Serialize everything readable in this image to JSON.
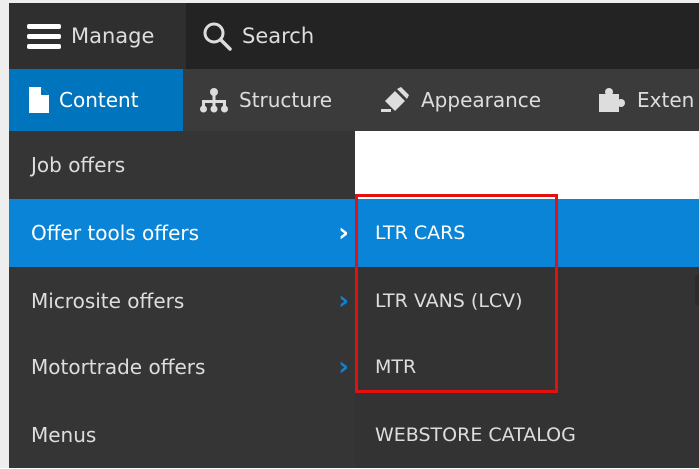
{
  "topbar": {
    "manage_label": "Manage",
    "search_label": "Search"
  },
  "tabs": [
    {
      "label": "Content",
      "icon": "document-icon",
      "active": true
    },
    {
      "label": "Structure",
      "icon": "sitemap-icon",
      "active": false
    },
    {
      "label": "Appearance",
      "icon": "paint-icon",
      "active": false
    },
    {
      "label": "Exten",
      "icon": "puzzle-icon",
      "active": false
    }
  ],
  "menu_level1": [
    {
      "label": "Job offers",
      "has_children": false,
      "active": false
    },
    {
      "label": "Offer tools offers",
      "has_children": true,
      "active": true
    },
    {
      "label": "Microsite offers",
      "has_children": true,
      "active": false
    },
    {
      "label": "Motortrade offers",
      "has_children": true,
      "active": false
    },
    {
      "label": "Menus",
      "has_children": false,
      "active": false
    }
  ],
  "menu_level2": [
    {
      "label": "LTR CARS",
      "active": true
    },
    {
      "label": "LTR VANS (LCV)",
      "active": false
    },
    {
      "label": "MTR",
      "active": false
    },
    {
      "label": "WEBSTORE CATALOG",
      "active": false
    }
  ],
  "colors": {
    "accent": "#0a84d6",
    "highlight_box": "#e41010",
    "toolbar_dark": "#232323",
    "menu_bg": "#353535"
  }
}
